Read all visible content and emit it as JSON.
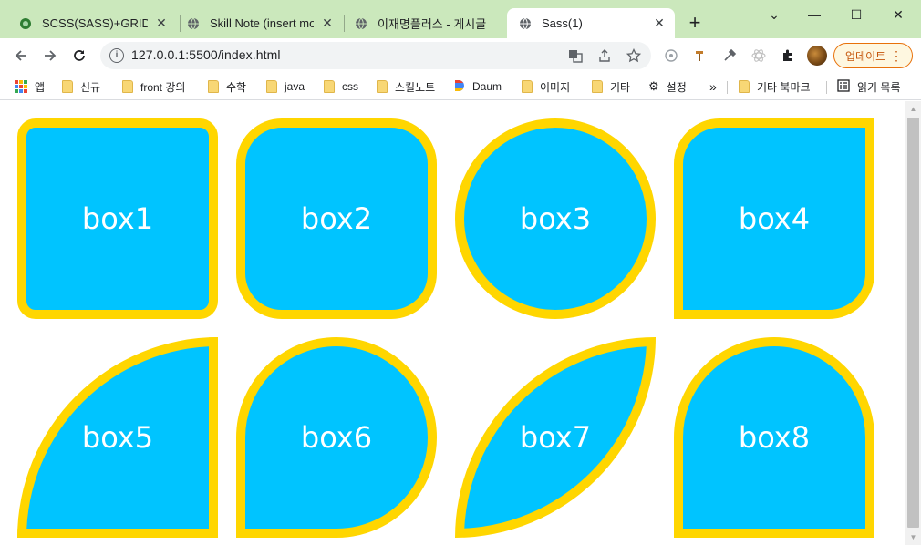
{
  "tabs": [
    {
      "title": "SCSS(SASS)+GRID+FL",
      "favicon": "green-grid-icon",
      "close": "✕"
    },
    {
      "title": "Skill Note (insert mod",
      "favicon": "globe-icon",
      "close": "✕"
    },
    {
      "title": "이재명플러스 - 게시글",
      "favicon": "globe-icon",
      "close": "✕"
    },
    {
      "title": "Sass(1)",
      "favicon": "globe-icon",
      "close": "✕",
      "active": true
    }
  ],
  "new_tab_label": "+",
  "window_controls": {
    "minimize": "—",
    "maximize": "☐",
    "close": "✕",
    "menu": "⌄"
  },
  "address_bar": {
    "url": "127.0.0.1:5500/index.html",
    "info_icon": "i"
  },
  "update_button": {
    "label": "업데이트",
    "menu": "⋮"
  },
  "bookmarks": {
    "items": [
      {
        "label": "앱",
        "icon": "apps-grid-icon"
      },
      {
        "label": "신규",
        "icon": "folder-icon"
      },
      {
        "label": "front 강의",
        "icon": "folder-icon"
      },
      {
        "label": "수학",
        "icon": "folder-icon"
      },
      {
        "label": "java",
        "icon": "folder-icon"
      },
      {
        "label": "css",
        "icon": "folder-icon"
      },
      {
        "label": "스킬노트",
        "icon": "folder-icon"
      },
      {
        "label": "Daum",
        "icon": "daum-logo-icon"
      },
      {
        "label": "이미지",
        "icon": "folder-icon"
      },
      {
        "label": "기타",
        "icon": "folder-icon"
      },
      {
        "label": "설정",
        "icon": "gear-icon"
      }
    ],
    "overflow": "»",
    "other_bookmarks": "기타 북마크",
    "reading_list": "읽기 목록"
  },
  "page": {
    "boxes": [
      {
        "label": "box1"
      },
      {
        "label": "box2"
      },
      {
        "label": "box3"
      },
      {
        "label": "box4"
      },
      {
        "label": "box5"
      },
      {
        "label": "box6"
      },
      {
        "label": "box7"
      },
      {
        "label": "box8"
      }
    ],
    "box_color": "#00c4ff",
    "border_color": "#ffd600"
  },
  "scrollbar": {
    "up": "▲",
    "down": "▼"
  }
}
